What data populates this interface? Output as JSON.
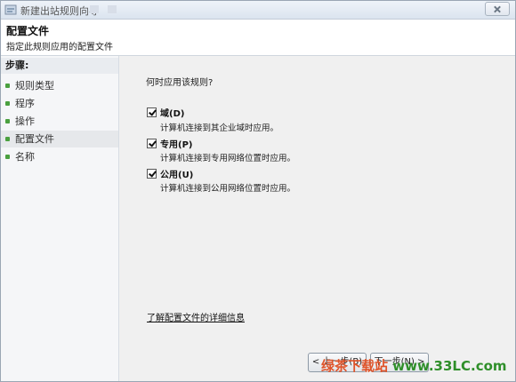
{
  "window": {
    "title": "新建出站规则向导"
  },
  "header": {
    "title": "配置文件",
    "subtitle": "指定此规则应用的配置文件"
  },
  "steps": {
    "heading": "步骤:",
    "items": [
      {
        "label": "规则类型",
        "active": false
      },
      {
        "label": "程序",
        "active": false
      },
      {
        "label": "操作",
        "active": false
      },
      {
        "label": "配置文件",
        "active": true
      },
      {
        "label": "名称",
        "active": false
      }
    ]
  },
  "main": {
    "question": "何时应用该规则?",
    "options": [
      {
        "label": "域(D)",
        "checked": true,
        "description": "计算机连接到其企业域时应用。"
      },
      {
        "label": "专用(P)",
        "checked": true,
        "description": "计算机连接到专用网络位置时应用。"
      },
      {
        "label": "公用(U)",
        "checked": true,
        "description": "计算机连接到公用网络位置时应用。"
      }
    ],
    "more_link": "了解配置文件的详细信息"
  },
  "buttons": {
    "back": "< 上一步(B)",
    "next": "下一步(N) >"
  },
  "watermark": {
    "text_a": "绿茶下载站",
    "text_b": " www.33LC.com"
  },
  "colors": {
    "accent_green": "#4aa03f",
    "watermark_orange": "#e0542a",
    "watermark_green": "#2f8f2a"
  }
}
